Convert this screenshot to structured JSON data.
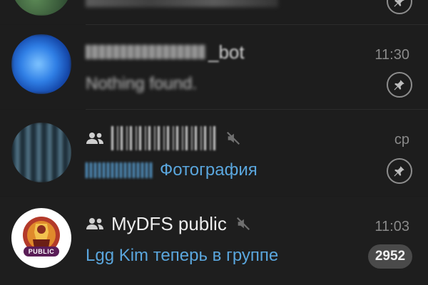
{
  "colors": {
    "accent": "#5aa6dd",
    "background": "#1d1d1d",
    "badge": "#4a4a4a",
    "muted": "#8a8a8a"
  },
  "chats": [
    {
      "name": "",
      "preview": "",
      "icons": [
        "pin-icon"
      ]
    },
    {
      "name": "_bot",
      "preview": "Nothing found.",
      "time": "11:30",
      "icons": [
        "pin-icon"
      ]
    },
    {
      "name": "",
      "preview": "Фотография",
      "time": "ср",
      "icons": [
        "group-icon",
        "mute-icon",
        "pin-icon"
      ]
    },
    {
      "name": "MyDFS public",
      "preview": "Lgg Kim теперь в группе",
      "time": "11:03",
      "unread": "2952",
      "avatar_label": "PUBLIC",
      "icons": [
        "group-icon",
        "mute-icon"
      ]
    }
  ]
}
